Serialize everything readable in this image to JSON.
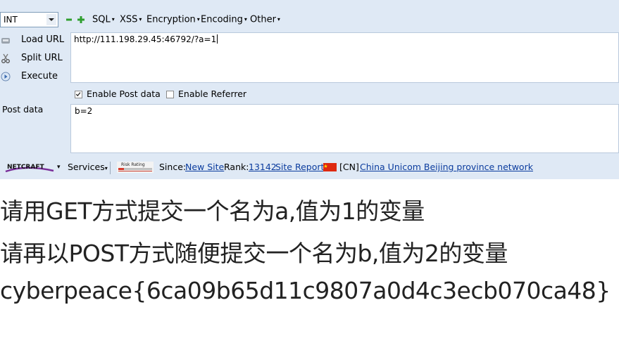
{
  "toolbar": {
    "select_value": "INT",
    "menus": [
      "SQL",
      "XSS",
      "Encryption",
      "Encoding",
      "Other"
    ]
  },
  "side": {
    "load_url": "Load URL",
    "split_url": "Split URL",
    "execute": "Execute"
  },
  "url_value": "http://111.198.29.45:46792/?a=1",
  "checks": {
    "post_label": "Enable Post data",
    "referrer_label": "Enable Referrer",
    "post_checked": true,
    "referrer_checked": false
  },
  "post": {
    "label": "Post data",
    "value": "b=2"
  },
  "netcraft": {
    "logo": "NETCRAFT",
    "services": "Services",
    "risk": "Risk Rating",
    "since_label": "Since:",
    "since_value": "New Site",
    "rank_label": "Rank:",
    "rank_value": "13142",
    "site_report": "Site Report",
    "country": "[CN]",
    "network": "China Unicom Beijing province network"
  },
  "output": {
    "line1": "请用GET方式提交一个名为a,值为1的变量",
    "line2": "请再以POST方式随便提交一个名为b,值为2的变量",
    "line3": "cyberpeace{6ca09b65d11c9807a0d4c3ecb070ca48}"
  },
  "colors": {
    "panel": "#dfe9f5",
    "link": "#0b3c9e",
    "plus_green": "#2f9e2f"
  }
}
